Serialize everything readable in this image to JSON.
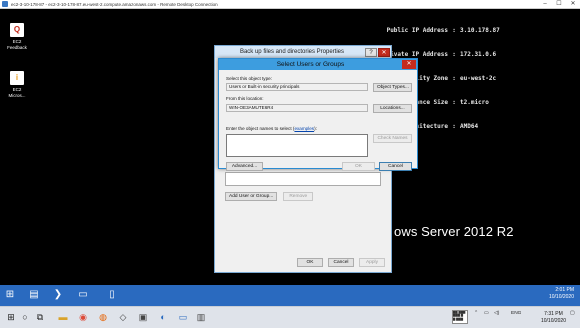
{
  "rdp_window": {
    "title": "ec2-3-10-178-87 - ec2-3-10-178-87.eu-west-2.compute.amazonaws.com - Remote Desktop Connection",
    "minimize": "–",
    "maximize": "☐",
    "close": "✕"
  },
  "desktop": {
    "icons": [
      {
        "label_line1": "EC2",
        "label_line2": "Feedback",
        "glyph": "Q"
      },
      {
        "label_line1": "EC2",
        "label_line2": "Micros...",
        "glyph": "i"
      }
    ],
    "bginfo": [
      {
        "key": "Public IP Address",
        "value": "3.10.178.87"
      },
      {
        "key": "Private IP Address",
        "value": "172.31.0.6"
      },
      {
        "key": "Availability Zone",
        "value": "eu-west-2c"
      },
      {
        "key": "Instance Size",
        "value": "t2.micro"
      },
      {
        "key": "Architecture",
        "value": "AMD64"
      }
    ],
    "brand_text": "ows Server 2012 R2"
  },
  "backup_dialog": {
    "title": "Back up files and directories Properties",
    "help_label": "?",
    "close_label": "✕",
    "add_button": "Add User or Group...",
    "remove_button": "Remove",
    "ok_button": "OK",
    "cancel_button": "Cancel",
    "apply_button": "Apply"
  },
  "select_dialog": {
    "title": "Select Users or Groups",
    "close_label": "✕",
    "object_type_label": "Select this object type:",
    "object_type_value": "Users or Built-in security principals",
    "object_types_button": "Object Types...",
    "location_label": "From this location:",
    "location_value": "WIN-OE3AMUTE6R4",
    "locations_button": "Locations...",
    "names_label_prefix": "Enter the object names to select (",
    "names_label_link": "examples",
    "names_label_suffix": "):",
    "names_value": "",
    "check_names_button": "Check Names",
    "advanced_button": "Advanced...",
    "ok_button": "OK",
    "cancel_button": "Cancel"
  },
  "remote_taskbar": {
    "time": "2:01 PM",
    "date": "10/10/2020"
  },
  "local_taskbar": {
    "tray_text": "ENG",
    "time": "7:31 PM",
    "date": "10/10/2020"
  }
}
